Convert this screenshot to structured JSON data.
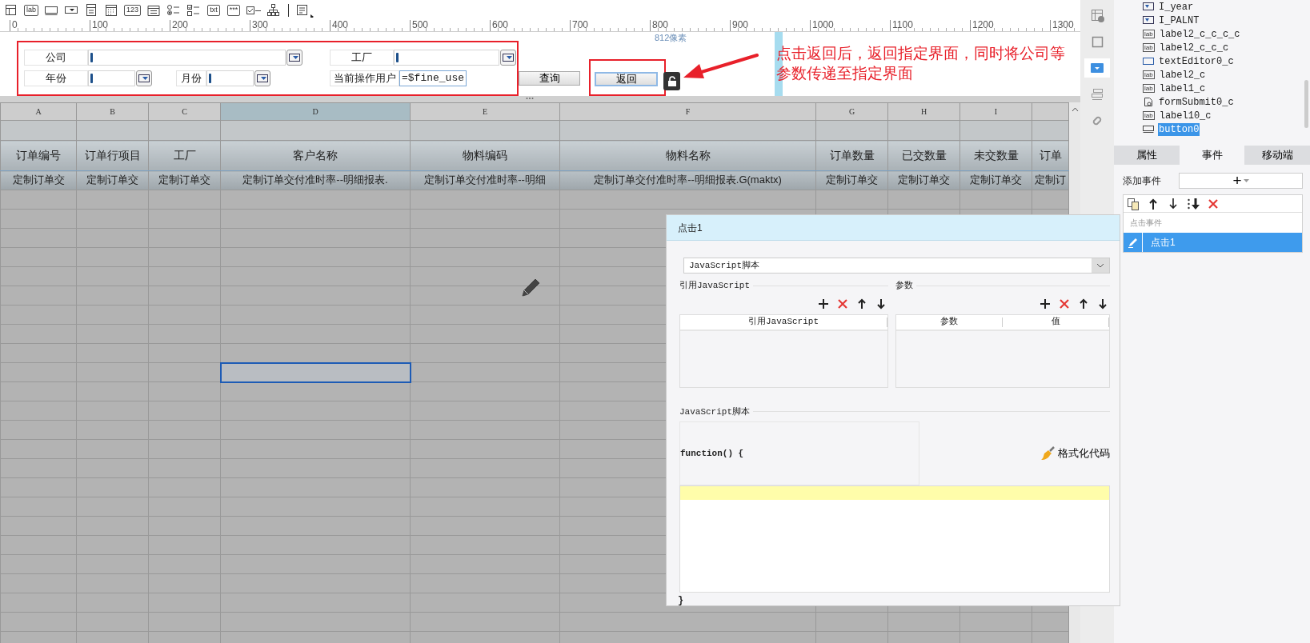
{
  "toolbar": [
    {
      "kind": "grid"
    },
    {
      "kind": "text",
      "text": "lab"
    },
    {
      "kind": "textbox"
    },
    {
      "kind": "combo"
    },
    {
      "kind": "panel"
    },
    {
      "kind": "calendar"
    },
    {
      "kind": "text",
      "text": "123"
    },
    {
      "kind": "textarea"
    },
    {
      "kind": "radio"
    },
    {
      "kind": "check"
    },
    {
      "kind": "text",
      "text": "txt"
    },
    {
      "kind": "text",
      "text": "***"
    },
    {
      "kind": "checkbox"
    },
    {
      "kind": "tree"
    },
    {
      "kind": "separator"
    },
    {
      "kind": "more"
    }
  ],
  "ruler": [
    "0",
    "100",
    "200",
    "300",
    "400",
    "500",
    "600",
    "700",
    "800",
    "900",
    "1000",
    "1100",
    "1200",
    "1300"
  ],
  "canvas": {
    "size_note": "812像素",
    "annotation": "点击返回后，返回指定界面，同时将公司等参数传递至指定界面",
    "widgets": [
      {
        "kind": "label",
        "text": "公司"
      },
      {
        "kind": "combo"
      },
      {
        "kind": "label",
        "text": "工厂"
      },
      {
        "kind": "combo"
      },
      {
        "kind": "label",
        "text": "年份"
      },
      {
        "kind": "combo"
      },
      {
        "kind": "label",
        "text": "月份"
      },
      {
        "kind": "combo"
      },
      {
        "kind": "label",
        "text": "当前操作用户"
      },
      {
        "kind": "field",
        "value": "=$fine_use"
      },
      {
        "kind": "button",
        "text": "查询",
        "selected": false
      },
      {
        "kind": "button",
        "text": "返回",
        "selected": true,
        "locked": false
      }
    ]
  },
  "sheet": {
    "columns": [
      {
        "letter": "A",
        "selected": false
      },
      {
        "letter": "B",
        "selected": false
      },
      {
        "letter": "C",
        "selected": false
      },
      {
        "letter": "D",
        "selected": true
      },
      {
        "letter": "E",
        "selected": false
      },
      {
        "letter": "F",
        "selected": false
      },
      {
        "letter": "G",
        "selected": false
      },
      {
        "letter": "H",
        "selected": false
      },
      {
        "letter": "I",
        "selected": false
      },
      {
        "selected": false
      }
    ],
    "header_row": [
      "订单编号",
      "订单行项目",
      "工厂",
      "客户名称",
      "物料编码",
      "物料名称",
      "订单数量",
      "已交数量",
      "未交数量",
      "订单"
    ],
    "data_row": [
      "定制订单交",
      "定制订单交",
      "定制订单交",
      "定制订单交付准时率--明细报表.",
      "定制订单交付准时率--明细",
      "定制订单交付准时率--明细报表.G(maktx)",
      "定制订单交",
      "定制订单交",
      "定制订单交",
      "定制订"
    ],
    "rows": [
      {
        "selected": false
      },
      {
        "selected": false
      },
      {
        "selected": false
      },
      {
        "selected": false
      },
      {
        "selected": false
      },
      {
        "selected": false
      },
      {
        "selected": false
      },
      {
        "selected": false
      },
      {
        "selected": false
      },
      {
        "selected": true
      },
      {
        "selected": false
      },
      {
        "selected": false
      },
      {
        "selected": false
      },
      {
        "selected": false
      },
      {
        "selected": false
      },
      {
        "selected": false
      },
      {
        "selected": false
      },
      {
        "selected": false
      },
      {
        "selected": false
      },
      {
        "selected": false
      },
      {
        "selected": false
      },
      {
        "selected": false
      },
      {
        "selected": false
      },
      {
        "selected": false
      }
    ]
  },
  "side_strip": [
    {
      "kind": "table-info",
      "selected": false
    },
    {
      "kind": "frame",
      "selected": false
    },
    {
      "kind": "dropdown",
      "selected": true
    },
    {
      "kind": "layout",
      "selected": false
    },
    {
      "kind": "link",
      "selected": false
    }
  ],
  "widget_tree": [
    {
      "kind": "combo",
      "label": "I_year",
      "selected": false
    },
    {
      "kind": "combo",
      "label": "I_PALNT",
      "selected": false
    },
    {
      "kind": "label",
      "badge": "lab",
      "label": "label2_c_c_c_c",
      "selected": false
    },
    {
      "kind": "label",
      "badge": "lab",
      "label": "label2_c_c_c",
      "selected": false
    },
    {
      "kind": "textbox",
      "label": "textEditor0_c",
      "selected": false
    },
    {
      "kind": "label",
      "badge": "lab",
      "label": "label2_c",
      "selected": false
    },
    {
      "kind": "label",
      "badge": "lab",
      "label": "label1_c",
      "selected": false
    },
    {
      "kind": "submit",
      "label": "formSubmit0_c",
      "selected": false
    },
    {
      "kind": "label",
      "badge": "lab",
      "label": "label10_c",
      "selected": false
    },
    {
      "kind": "button",
      "label": "button0",
      "selected": true
    }
  ],
  "panel_tabs": [
    {
      "label": "属性",
      "selected": false
    },
    {
      "label": "事件",
      "selected": true
    },
    {
      "label": "移动端",
      "selected": false
    }
  ],
  "events": {
    "add_label": "添加事件",
    "add_button": "+",
    "list_header": "点击事件",
    "items": [
      {
        "label": "点击1",
        "selected": true
      }
    ]
  },
  "dialog": {
    "title": "点击1",
    "type_value": "JavaScript脚本",
    "ref_section": {
      "title": "引用JavaScript",
      "columns": [
        "引用JavaScript"
      ]
    },
    "param_section": {
      "title": "参数",
      "columns": [
        "参数",
        "值"
      ]
    },
    "script_section": {
      "title": "JavaScript脚本",
      "head_line": "function() {",
      "format_button": "格式化代码",
      "tail_line": "}"
    }
  }
}
